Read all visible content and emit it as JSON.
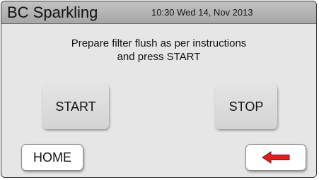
{
  "header": {
    "title": "BC Sparkling",
    "datetime": "10:30 Wed 14, Nov 2013"
  },
  "instruction": {
    "line1": "Prepare filter flush as per instructions",
    "line2": "and press START"
  },
  "buttons": {
    "start_label": "START",
    "stop_label": "STOP",
    "home_label": "HOME",
    "back_icon": "left-arrow-icon"
  },
  "colors": {
    "back_arrow": "#e01e1e"
  }
}
